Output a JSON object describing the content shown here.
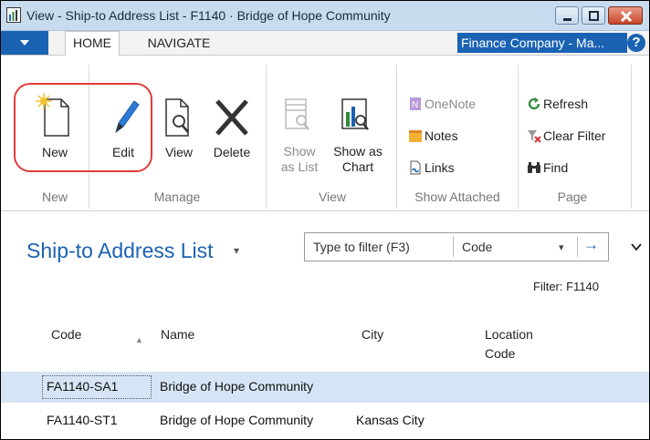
{
  "window": {
    "title": "View - Ship-to Address List - F1140 · Bridge of Hope Community",
    "minimize_icon": "minimize-icon",
    "maximize_icon": "maximize-icon",
    "close_icon": "close-icon"
  },
  "tabs": [
    {
      "label": "HOME",
      "active": true
    },
    {
      "label": "NAVIGATE",
      "active": false
    }
  ],
  "company": "Finance Company - Ma...",
  "help_label": "?",
  "ribbon": {
    "groups": {
      "new": {
        "label": "New",
        "buttons": [
          {
            "label": "New",
            "icon": "new-document-icon"
          }
        ]
      },
      "manage": {
        "label": "Manage",
        "buttons": [
          {
            "label": "Edit",
            "icon": "pencil-icon"
          },
          {
            "label": "View",
            "icon": "view-document-icon"
          },
          {
            "label": "Delete",
            "icon": "delete-x-icon"
          }
        ]
      },
      "view": {
        "label": "View",
        "buttons": [
          {
            "label_line1": "Show",
            "label_line2": "as List",
            "icon": "list-icon",
            "enabled": false
          },
          {
            "label_line1": "Show as",
            "label_line2": "Chart",
            "icon": "chart-icon",
            "enabled": true
          }
        ]
      },
      "show_attached": {
        "label": "Show Attached",
        "buttons": [
          {
            "label": "OneNote",
            "icon": "onenote-icon",
            "enabled": false
          },
          {
            "label": "Notes",
            "icon": "notes-icon",
            "enabled": true
          },
          {
            "label": "Links",
            "icon": "links-icon",
            "enabled": true
          }
        ]
      },
      "page": {
        "label": "Page",
        "buttons": [
          {
            "label": "Refresh",
            "icon": "refresh-icon"
          },
          {
            "label": "Clear Filter",
            "icon": "clear-filter-icon"
          },
          {
            "label": "Find",
            "icon": "binoculars-icon"
          }
        ]
      }
    }
  },
  "page": {
    "title": "Ship-to Address List",
    "title_caret": "▾",
    "filter": {
      "placeholder": "Type to filter (F3)",
      "field": "Code",
      "dropdown_glyph": "▾",
      "go_glyph": "→"
    },
    "collapse_glyph": "⌄",
    "filter_status": "Filter: F1140"
  },
  "table": {
    "columns": [
      {
        "key": "code",
        "line1": "Code",
        "line2": ""
      },
      {
        "key": "name",
        "line1": "Name",
        "line2": ""
      },
      {
        "key": "city",
        "line1": "City",
        "line2": ""
      },
      {
        "key": "location_code",
        "line1": "Location",
        "line2": "Code"
      }
    ],
    "sort_indicator": "▲",
    "rows": [
      {
        "code": "FA1140-SA1",
        "name": "Bridge of Hope Community",
        "city": "",
        "location_code": "",
        "selected": true
      },
      {
        "code": "FA1140-ST1",
        "name": "Bridge of Hope Community",
        "city": "Kansas City",
        "location_code": "",
        "selected": false
      }
    ]
  },
  "colors": {
    "accent": "#1a63b3",
    "title_bar": "#c9dcef",
    "selected_row": "#d6e5f5",
    "highlight_ring": "#e23b3b"
  }
}
